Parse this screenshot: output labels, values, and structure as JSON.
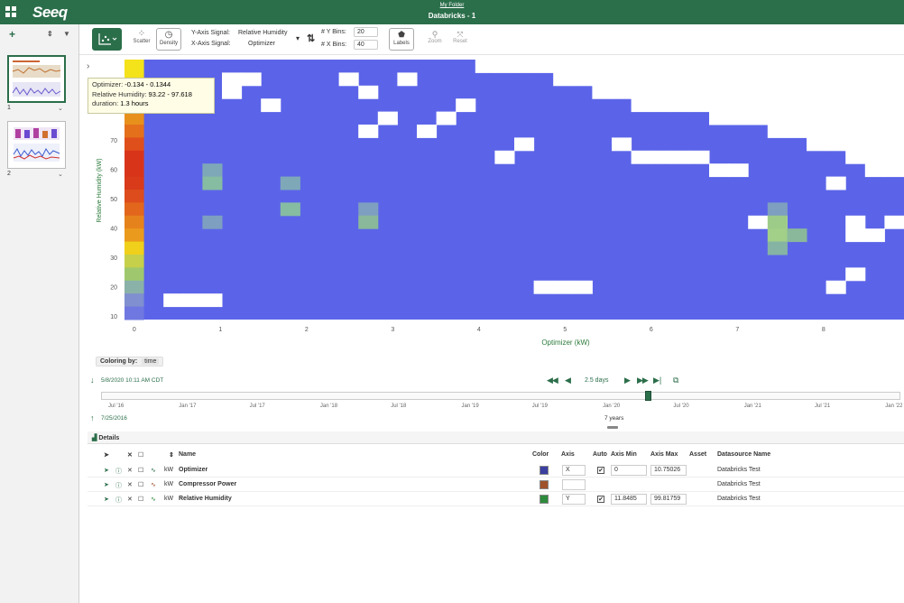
{
  "header": {
    "app_name": "Seeq",
    "breadcrumb": "My Folder",
    "title": "Databricks - 1"
  },
  "left_panel": {
    "add_icon": "plus-icon",
    "sort_icon": "sort-icon",
    "filter_icon": "filter-icon",
    "worksheets": [
      {
        "number": "1"
      },
      {
        "number": "2"
      }
    ]
  },
  "toolbar": {
    "scatter_label": "Scatter",
    "density_label": "Density",
    "y_axis_signal_label": "Y-Axis Signal:",
    "y_axis_signal_value": "Relative Humidity",
    "x_axis_signal_label": "X-Axis Signal:",
    "x_axis_signal_value": "Optimizer",
    "y_bins_label": "# Y Bins:",
    "y_bins_value": "20",
    "x_bins_label": "# X Bins:",
    "x_bins_value": "40",
    "labels_label": "Labels",
    "zoom_label": "Zoom",
    "reset_label": "Reset"
  },
  "tooltip": {
    "line1_label": "Optimizer:",
    "line1_value": "-0.134 - 0.1344",
    "line2_label": "Relative Humidity:",
    "line2_value": "93.22 - 97.618",
    "line3_label": "duration:",
    "line3_value": "1.3 hours"
  },
  "chart_data": {
    "type": "heatmap",
    "xlabel": "Optimizer (kW)",
    "ylabel": "Relative Humidity (kW)",
    "x_ticks": [
      "0",
      "1",
      "2",
      "3",
      "4",
      "5",
      "6",
      "7",
      "8"
    ],
    "y_ticks": [
      "10",
      "20",
      "30",
      "40",
      "50",
      "60",
      "70"
    ],
    "x_range": [
      -0.134,
      10.75
    ],
    "y_range": [
      9.25,
      100
    ],
    "x_bins": 40,
    "y_bins": 20,
    "colors": {
      "low": "#5b64e8",
      "mid": "#8ad08a",
      "high": "#f4e21a",
      "max": "#d8341a"
    }
  },
  "coloring": {
    "label": "Coloring by:",
    "value": "time"
  },
  "timebar": {
    "end_label": "5/8/2020 10:11 AM  CDT",
    "start_label": "7/25/2016",
    "duration_label": "2.5 days",
    "range_label": "7 years",
    "ticks": [
      "Jul '16",
      "Jan '17",
      "Jul '17",
      "Jan '18",
      "Jul '18",
      "Jan '19",
      "Jul '19",
      "Jan '20",
      "Jul '20",
      "Jan '21",
      "Jul '21",
      "Jan '22"
    ]
  },
  "details": {
    "title": "Details",
    "columns": {
      "name": "Name",
      "color": "Color",
      "axis": "Axis",
      "auto": "Auto",
      "axis_min": "Axis Min",
      "axis_max": "Axis Max",
      "asset": "Asset",
      "datasource": "Datasource Name"
    },
    "rows": [
      {
        "unit": "kW",
        "name": "Optimizer",
        "color": "#3b3fa0",
        "axis": "X",
        "auto": true,
        "axis_min": "0",
        "axis_max": "10.75026",
        "datasource": "Databricks Test"
      },
      {
        "unit": "kW",
        "name": "Compressor Power",
        "color": "#a0522d",
        "axis": "",
        "auto": false,
        "axis_min": "",
        "axis_max": "",
        "datasource": "Databricks Test"
      },
      {
        "unit": "kW",
        "name": "Relative Humidity",
        "color": "#2e8b3e",
        "axis": "Y",
        "auto": true,
        "axis_min": "11.8485",
        "axis_max": "99.81759",
        "datasource": "Databricks Test"
      }
    ]
  }
}
